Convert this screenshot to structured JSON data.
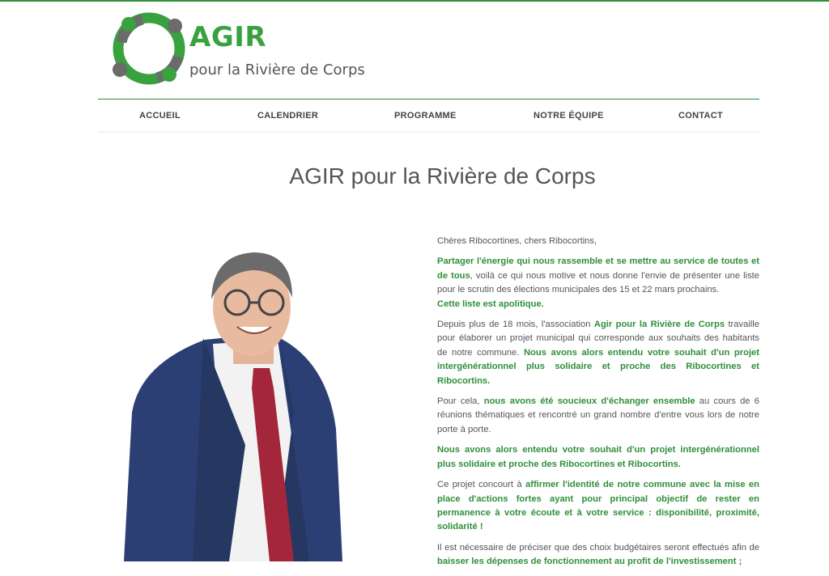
{
  "brand": {
    "title": "AGIR",
    "subtitle": "pour la Rivière de Corps",
    "colors": {
      "green": "#3aa13f",
      "grey": "#6b6b6b"
    }
  },
  "nav": {
    "items": [
      {
        "label": "ACCUEIL"
      },
      {
        "label": "CALENDRIER"
      },
      {
        "label": "PROGRAMME"
      },
      {
        "label": "NOTRE ÉQUIPE"
      },
      {
        "label": "CONTACT"
      }
    ]
  },
  "main": {
    "title": "AGIR pour la Rivière de Corps",
    "photo_icon": "candidate-portrait",
    "paragraphs": {
      "greeting": "Chères Ribocortines, chers Ribocortins,",
      "p1_bold": "Partager l'énergie qui nous rassemble et se mettre au service de toutes et de tous",
      "p1_text": ", voilà ce qui nous motive et nous donne l'envie de présenter une liste pour le scrutin des élections municipales des 15 et 22 mars prochains.",
      "p1_bold2": "Cette liste est apolitique.",
      "p2_a": "Depuis plus de 18 mois, l'association ",
      "p2_bold": "Agir pour la Rivière de Corps",
      "p2_b": " travaille pour élaborer un projet municipal qui corresponde aux souhaits des habitants de notre commune. ",
      "p2_bold2": "Nous avons alors entendu votre souhait d'un projet intergénérationnel plus solidaire et proche des Ribocortines et Ribocortins.",
      "p3_a": "Pour cela, ",
      "p3_bold": "nous avons été soucieux d'échanger ensemble",
      "p3_b": " au cours de 6 réunions thématiques et rencontré un grand nombre d'entre vous lors de notre porte à porte.",
      "p4_bold": "Nous avons alors entendu votre souhait d'un projet intergénérationnel plus solidaire et proche des Ribocortines et Ribocortins.",
      "p5_a": "Ce projet concourt à ",
      "p5_bold": "affirmer l'identité de notre commune avec la mise en place d'actions fortes ayant pour principal objectif de rester en permanence à votre écoute et à votre service : disponibilité, proximité, solidarité !",
      "p6_a": "Il est nécessaire de préciser que des choix budgétaires seront effectués afin de ",
      "p6_bold": "baisser les dépenses de fonctionnement au profit de l'investissement ;"
    }
  }
}
